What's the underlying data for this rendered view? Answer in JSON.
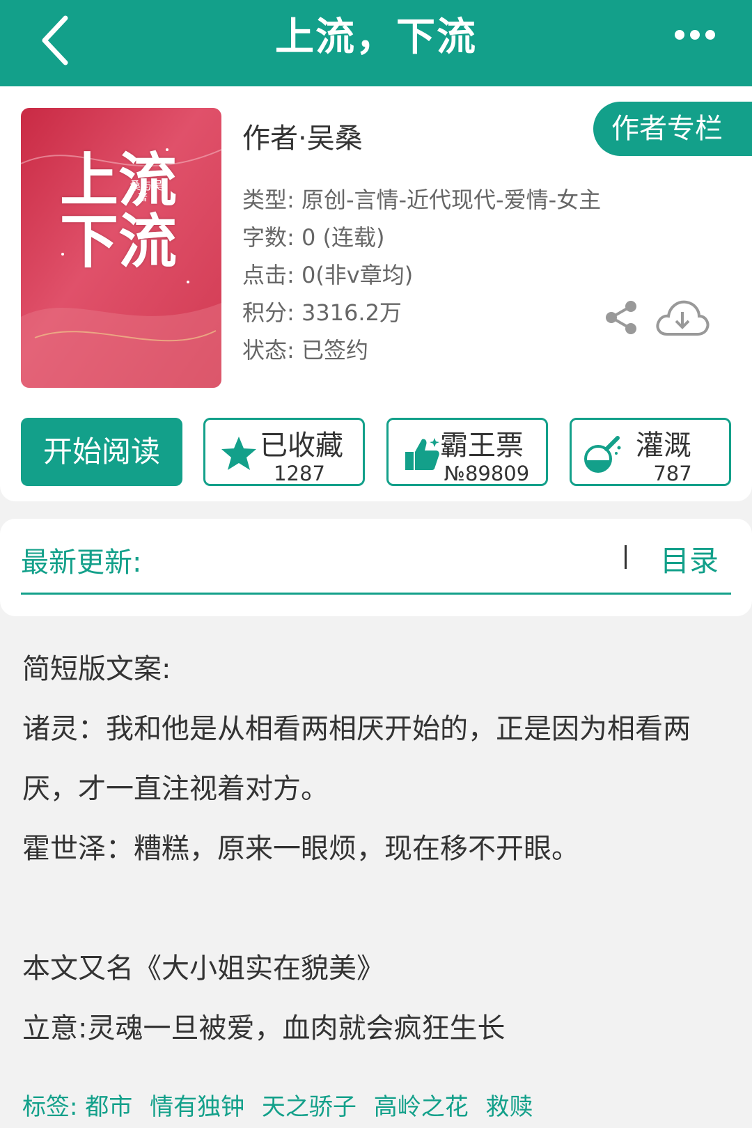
{
  "header": {
    "title": "上流，下流",
    "back_icon": "chevron-left-icon",
    "more_icon": "more-dots-icon"
  },
  "colors": {
    "accent": "#13a08a",
    "cover_red": "#d8384f"
  },
  "book": {
    "cover_title": "上流下流",
    "cover_author": "桑与吴",
    "cover_suffix": "著",
    "author_line": "作者·吴桑",
    "author_column_button": "作者专栏",
    "meta": [
      "类型: 原创-言情-近代现代-爱情-女主",
      "字数: 0 (连载)",
      "点击: 0(非v章均)",
      "积分: 3316.2万",
      "状态: 已签约"
    ]
  },
  "actions": {
    "read": "开始阅读",
    "collect": {
      "label": "已收藏",
      "count": "1287",
      "icon": "star-icon"
    },
    "ticket": {
      "label": "霸王票",
      "count": "№89809",
      "icon": "thumbs-up-icon"
    },
    "water": {
      "label": "灌溉",
      "count": "787",
      "icon": "flask-icon"
    }
  },
  "update": {
    "latest_label": "最新更新:",
    "catalog": "目录"
  },
  "description": {
    "heading": "简短版文案:",
    "line1": "诸灵：我和他是从相看两相厌开始的，正是因为相看两厌，才一直注视着对方。",
    "line2": "霍世泽：糟糕，原来一眼烦，现在移不开眼。",
    "line3": "本文又名《大小姐实在貌美》",
    "line4": "立意:灵魂一旦被爱，血肉就会疯狂生长"
  },
  "tags": {
    "label": "标签:",
    "items": [
      "都市",
      "情有独钟",
      "天之骄子",
      "高岭之花",
      "救赎"
    ]
  }
}
